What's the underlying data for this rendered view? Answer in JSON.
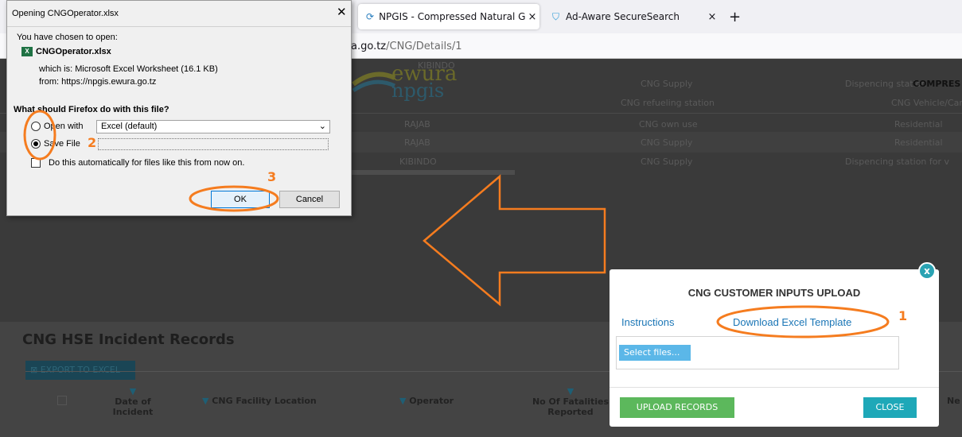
{
  "browser": {
    "tabs": [
      {
        "title": "NPGIS - Compressed Natural Ga",
        "active": true
      },
      {
        "title": "Ad-Aware SecureSearch",
        "active": false
      }
    ],
    "url_host": "a.go.tz",
    "url_path": "/CNG/Details/1"
  },
  "background_table": {
    "header_right": "COMPRES",
    "rows": [
      {
        "operator": "KIBINDO",
        "use": "CNG Supply",
        "type": "Dispencing station"
      },
      {
        "operator": "",
        "use": "CNG refueling station",
        "type": "CNG Vehicle/Cars"
      },
      {
        "operator": "RAJAB",
        "use": "CNG own use",
        "type": "Residential"
      },
      {
        "operator": "RAJAB",
        "use": "CNG Supply",
        "type": "Residential"
      },
      {
        "operator": "KIBINDO",
        "use": "CNG Supply",
        "type": "Dispencing station for v"
      }
    ]
  },
  "logo": {
    "line1": "ewura",
    "line2": "npgis"
  },
  "hse": {
    "title": "CNG HSE Incident Records",
    "export_label": "EXPORT TO EXCEL",
    "columns": [
      "Date of Incident",
      "CNG Facility Location",
      "Operator",
      "No Of Fatalities Reported",
      "Ne"
    ]
  },
  "download_dialog": {
    "title": "Opening CNGOperator.xlsx",
    "chosen_text": "You have chosen to open:",
    "filename": "CNGOperator.xlsx",
    "which_is": "which is: Microsoft Excel Worksheet (16.1 KB)",
    "from": "from: https://npgis.ewura.go.tz",
    "question": "What should Firefox do with this file?",
    "open_with_label": "Open with",
    "open_with_value": "Excel (default)",
    "save_file_label": "Save File",
    "auto_label": "Do this automatically for files like this from now on.",
    "ok_label": "OK",
    "cancel_label": "Cancel",
    "selected_option": "Save File"
  },
  "upload_modal": {
    "title": "CNG CUSTOMER INPUTS UPLOAD",
    "instructions_link": "Instructions",
    "download_link": "Download Excel Template",
    "select_files": "Select files...",
    "upload_button": "UPLOAD RECORDS",
    "close_button": "CLOSE",
    "close_x": "x"
  },
  "annotations": {
    "step1": "1",
    "step2": "2",
    "step3": "3",
    "color": "#f57c1f"
  }
}
